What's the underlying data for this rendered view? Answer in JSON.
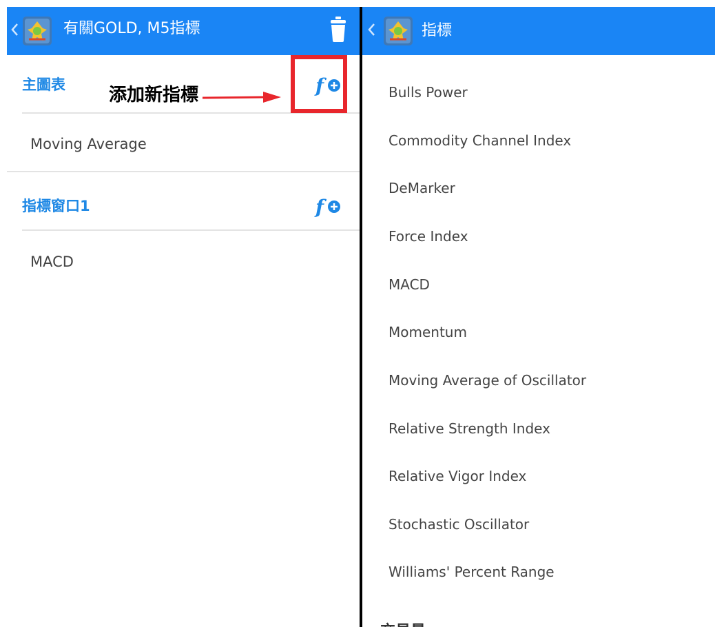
{
  "left_panel": {
    "title": "有關GOLD, M5指標",
    "annotation": "添加新指標",
    "main_chart": {
      "title": "主圖表",
      "indicators": [
        "Moving Average"
      ]
    },
    "indicator_window": {
      "title": "指標窗口1",
      "indicators": [
        "MACD"
      ]
    }
  },
  "right_panel": {
    "title": "指標",
    "items": [
      "Bulls Power",
      "Commodity Channel Index",
      "DeMarker",
      "Force Index",
      "MACD",
      "Momentum",
      "Moving Average of Oscillator",
      "Relative Strength Index",
      "Relative Vigor Index",
      "Stochastic Oscillator",
      "Williams' Percent Range"
    ],
    "next_section": "交易量"
  },
  "colors": {
    "appbar": "#1a85f5",
    "accent": "#1e88e5",
    "highlight": "#e8262c",
    "text": "#444444"
  },
  "icons": [
    "chevron-left-icon",
    "metatrader-logo-icon",
    "trash-icon",
    "add-indicator-icon",
    "arrow-right-icon"
  ]
}
